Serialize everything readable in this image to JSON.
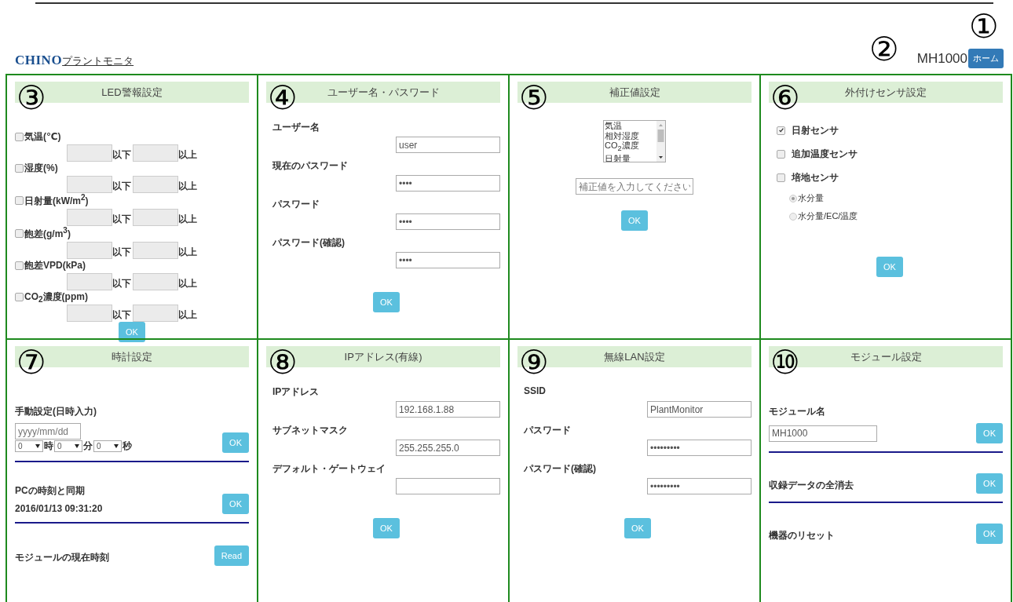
{
  "header": {
    "logo": "CHINO",
    "app_link": "プラントモニタ",
    "device_name": "MH1000",
    "home_button": "ホーム",
    "device_marker": "②",
    "home_marker": "①"
  },
  "panels": [
    {
      "kind": "alarm",
      "marker": "③",
      "title": "LED警報設定",
      "rows": [
        {
          "label": "気温(℃)",
          "checked": false,
          "below": "以下",
          "above": "以上"
        },
        {
          "label": "湿度(%)",
          "checked": false,
          "below": "以下",
          "above": "以上"
        },
        {
          "label": "日射量(kW/m$^{2}$)",
          "checked": false,
          "below": "以下",
          "above": "以上"
        },
        {
          "label": "飽差(g/m$^{3}$)",
          "checked": false,
          "below": "以下",
          "above": "以上"
        },
        {
          "label": "飽差VPD(kPa)",
          "checked": false,
          "below": "以下",
          "above": "以上"
        },
        {
          "label": "CO$_{2}$濃度(ppm)",
          "checked": false,
          "below": "以下",
          "above": "以上"
        }
      ],
      "button": "OK"
    },
    {
      "kind": "form",
      "marker": "④",
      "title": "ユーザー名・パスワード",
      "fields": [
        {
          "label": "ユーザー名",
          "value": "user"
        },
        {
          "label": "現在のパスワード",
          "value": "••••"
        },
        {
          "label": "パスワード",
          "value": "••••"
        },
        {
          "label": "パスワード(確認)",
          "value": "••••"
        }
      ],
      "button": "OK"
    },
    {
      "kind": "correction",
      "marker": "⑤",
      "title": "補正値設定",
      "options": [
        "気温",
        "相対湿度",
        "CO$_{2}$濃度",
        "日射量"
      ],
      "placeholder": "補正値を入力してください",
      "button": "OK"
    },
    {
      "kind": "sensors",
      "marker": "⑥",
      "title": "外付けセンサ設定",
      "checks": [
        {
          "label": "日射センサ",
          "checked": true
        },
        {
          "label": "追加温度センサ",
          "checked": false
        },
        {
          "label": "培地センサ",
          "checked": false
        }
      ],
      "radios": [
        {
          "label": "水分量",
          "selected": true
        },
        {
          "label": "水分量/EC/温度",
          "selected": false
        }
      ],
      "button": "OK"
    },
    {
      "kind": "clock",
      "marker": "⑦",
      "title": "時計設定",
      "manual_label": "手動設定(日時入力)",
      "date_placeholder": "yyyy/mm/dd",
      "selects": [
        {
          "value": "0",
          "unit": "時"
        },
        {
          "value": "0",
          "unit": "分"
        },
        {
          "value": "0",
          "unit": "秒"
        }
      ],
      "manual_button": "OK",
      "sync_label": "PCの時刻と同期",
      "sync_time": "2016/01/13 09:31:20",
      "sync_button": "OK",
      "module_time_label": "モジュールの現在時刻",
      "read_button": "Read"
    },
    {
      "kind": "form",
      "marker": "⑧",
      "title": "IPアドレス(有線)",
      "fields": [
        {
          "label": "IPアドレス",
          "value": "192.168.1.88"
        },
        {
          "label": "サブネットマスク",
          "value": "255.255.255.0"
        },
        {
          "label": "デフォルト・ゲートウェイ"
        }
      ],
      "button": "OK"
    },
    {
      "kind": "form",
      "marker": "⑨",
      "title": "無線LAN設定",
      "fields": [
        {
          "label": "SSID",
          "value": "PlantMonitor"
        },
        {
          "label": "パスワード",
          "value": "•••••••••"
        },
        {
          "label": "パスワード(確認)",
          "value": "•••••••••"
        }
      ],
      "button": "OK"
    },
    {
      "kind": "module",
      "marker": "⑩",
      "title": "モジュール設定",
      "name_label": "モジュール名",
      "name_value": "MH1000",
      "name_button": "OK",
      "actions": [
        {
          "label": "収録データの全消去",
          "button": "OK"
        },
        {
          "label": "機器のリセット",
          "button": "OK"
        }
      ]
    }
  ]
}
